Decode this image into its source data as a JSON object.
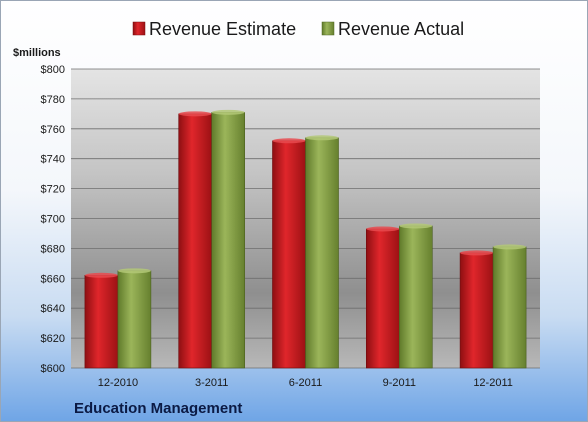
{
  "chart_data": {
    "type": "bar",
    "unit_label": "$millions",
    "company": "Education Management",
    "categories": [
      "12-2010",
      "3-2011",
      "6-2011",
      "9-2011",
      "12-2011"
    ],
    "series": [
      {
        "name": "Revenue Estimate",
        "values": [
          662,
          770,
          752,
          693,
          677
        ]
      },
      {
        "name": "Revenue Actual",
        "values": [
          665,
          771,
          754,
          695,
          681
        ]
      }
    ],
    "ylim": [
      600,
      800
    ],
    "yticks": [
      600,
      620,
      640,
      660,
      680,
      700,
      720,
      740,
      760,
      780,
      800
    ],
    "ytick_labels": [
      "$600",
      "$620",
      "$640",
      "$660",
      "$680",
      "$700",
      "$720",
      "$740",
      "$760",
      "$780",
      "$800"
    ],
    "legend_position": "top",
    "grid": true,
    "colors": {
      "Revenue Estimate": "#c8161d",
      "Revenue Actual": "#7f9a3e"
    }
  }
}
